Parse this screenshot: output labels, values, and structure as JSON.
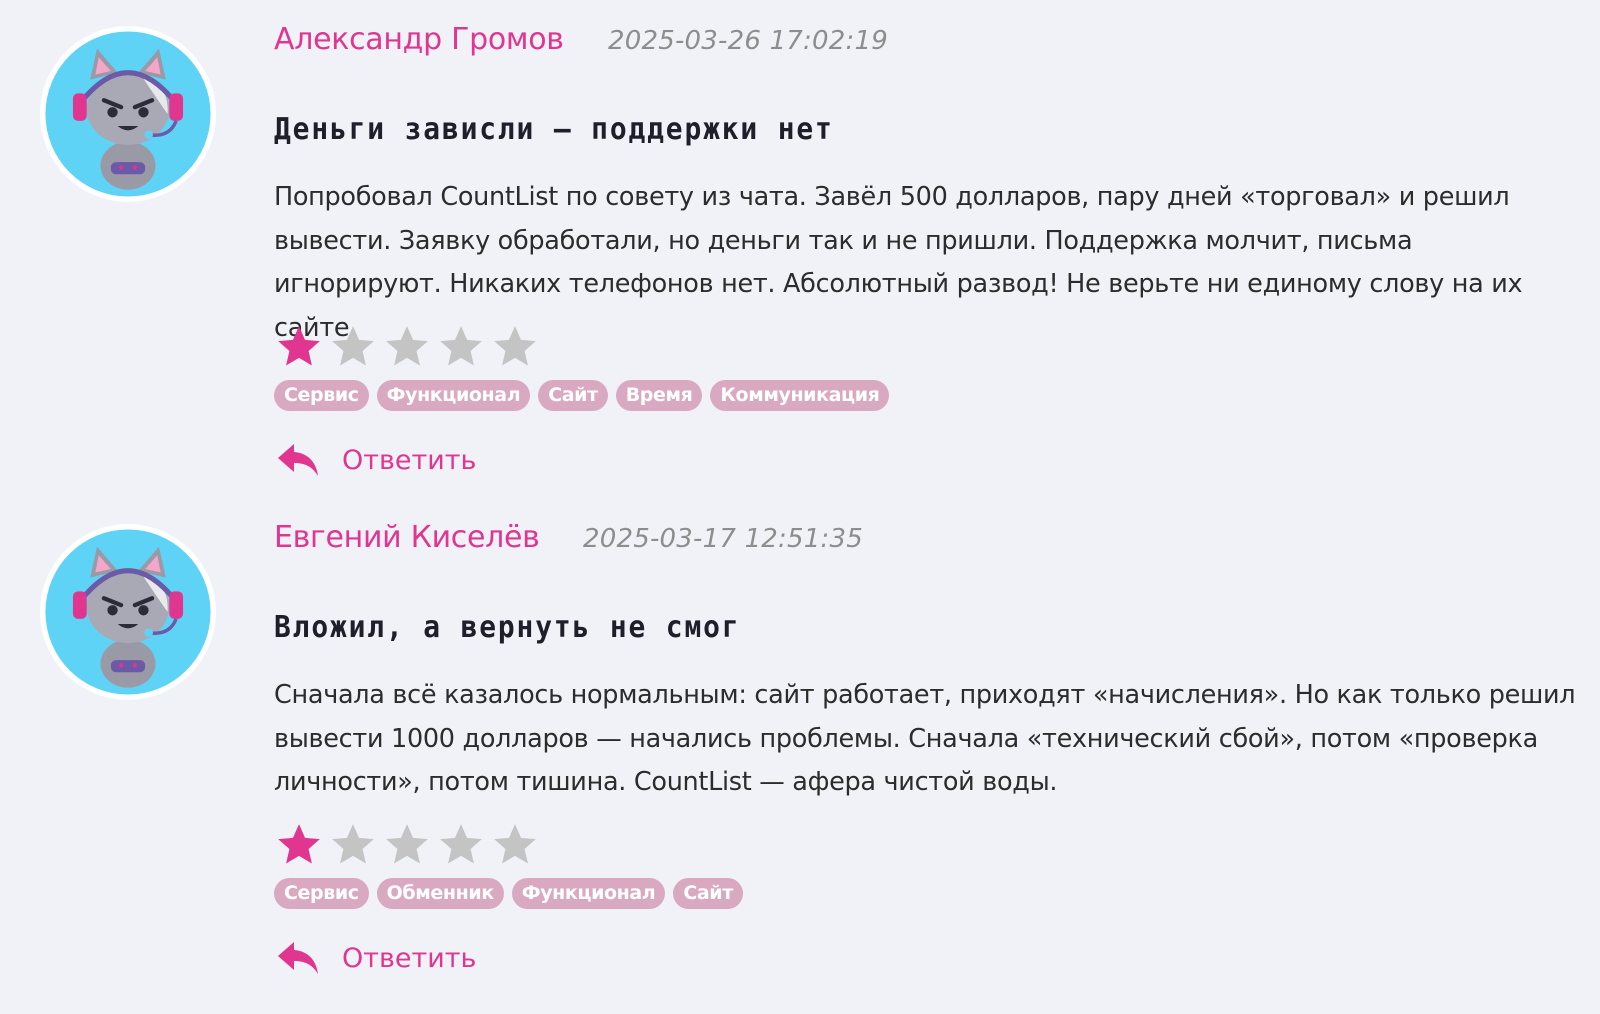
{
  "colors": {
    "accent": "#e0368f",
    "star_filled": "#e0368f",
    "star_empty": "#c4c4c4",
    "tag_bg": "#d9a9c1",
    "page_bg": "#f1f2f8"
  },
  "reviews": [
    {
      "author": "Александр Громов",
      "date": "2025-03-26 17:02:19",
      "title": "Деньги зависли — поддержки нет",
      "text": "Попробовал CountList по совету из чата. Завёл 500 долларов, пару дней «торговал» и решил вывести. Заявку обработали, но деньги так и не пришли. Поддержка молчит, письма игнорируют. Никаких телефонов нет. Абсолютный развод! Не верьте ни единому слову на их сайте.",
      "rating": 1,
      "rating_max": 5,
      "tags": [
        "Сервис",
        "Функционал",
        "Сайт",
        "Время",
        "Коммуникация"
      ],
      "reply_label": "Ответить",
      "avatar_icon": "cat-gamer-avatar-icon"
    },
    {
      "author": "Евгений Киселёв",
      "date": "2025-03-17 12:51:35",
      "title": "Вложил, а вернуть не смог",
      "text": "Сначала всё казалось нормальным: сайт работает, приходят «начисления». Но как только решил вывести 1000 долларов — начались проблемы. Сначала «технический сбой», потом «проверка личности», потом тишина. CountList — афера чистой воды.",
      "rating": 1,
      "rating_max": 5,
      "tags": [
        "Сервис",
        "Обменник",
        "Функционал",
        "Сайт"
      ],
      "reply_label": "Ответить",
      "avatar_icon": "cat-gamer-avatar-icon"
    }
  ]
}
